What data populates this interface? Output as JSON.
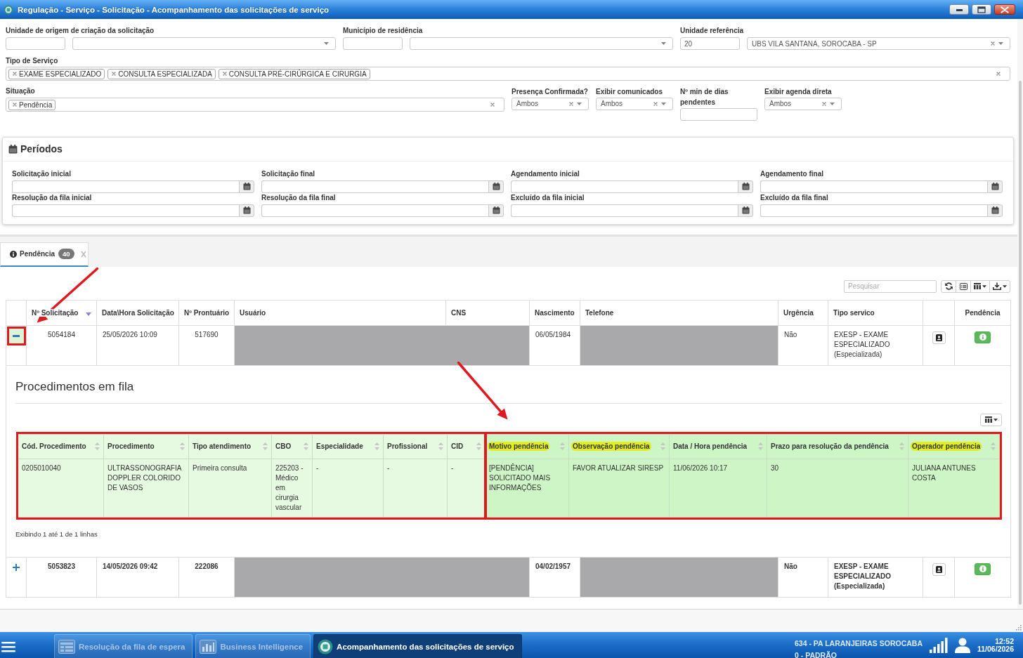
{
  "window": {
    "title": "Regulação - Serviço - Solicitação - Acompanhamento das solicitações de serviço"
  },
  "filters": {
    "lookups": [
      {
        "label": "Unidade de origem de criação da solicitação"
      },
      {
        "label": "Município de residência"
      },
      {
        "label": "Unidade referência",
        "code": "20",
        "value": "UBS VILA SANTANA, SOROCABA - SP"
      }
    ],
    "service_type": {
      "label": "Tipo de Serviço",
      "tags": [
        "EXAME ESPECIALIZADO",
        "CONSULTA ESPECIALIZADA",
        "CONSULTA PRÉ-CIRÚRGICA E CIRURGIA"
      ]
    },
    "situation": {
      "label": "Situação",
      "tags": [
        "Pendência"
      ]
    },
    "options": [
      {
        "kind": "select",
        "label": "Presença Confirmada?",
        "value": "Ambos"
      },
      {
        "kind": "select",
        "label": "Exibir comunicados",
        "value": "Ambos"
      },
      {
        "kind": "number",
        "label": "Nº min de dias pendentes"
      },
      {
        "kind": "select",
        "label": "Exibir agenda direta",
        "value": "Ambos"
      }
    ]
  },
  "periods": {
    "title": "Períodos",
    "fields": [
      "Solicitação inicial",
      "Solicitação final",
      "Agendamento inicial",
      "Agendamento final",
      "Resolução da fila inicial",
      "Resolução da fila final",
      "Excluído da fila inicial",
      "Excluído da fila final"
    ]
  },
  "tabs": [
    {
      "label": "Pendência",
      "count": "40",
      "selected": true
    }
  ],
  "search": {
    "placeholder": "Pesquisar"
  },
  "table": {
    "columns": [
      {
        "label": "Nº Solicitação",
        "sorted": true
      },
      {
        "label": "Data\\Hora Solicitação",
        "sorted": false
      },
      {
        "label": "Nº Prontuário",
        "sorted": false
      },
      {
        "label": "Usuário",
        "sorted": false
      },
      {
        "label": "CNS",
        "sorted": false
      },
      {
        "label": "Nascimento",
        "sorted": false
      },
      {
        "label": "Telefone",
        "sorted": false
      },
      {
        "label": "Urgência",
        "sorted": false
      },
      {
        "label": "Tipo servico",
        "sorted": false
      },
      {
        "label": "Pendência",
        "sorted": false
      }
    ],
    "rows": [
      {
        "expanded": true,
        "marked": true,
        "emphasized": false,
        "redacted": true,
        "number": "5054184",
        "requested_at": "25/05/2026 10:09",
        "record": "517690",
        "birth_date": "06/05/1984",
        "urgency": "Não",
        "service_type": "EXESP - EXAME ESPECIALIZADO (Especializada)",
        "detail": {
          "title": "Procedimentos em fila",
          "table": {
            "groups": [
              {
                "kind": "procedure",
                "marked": true,
                "columns": [
                  {
                    "label": "Cód. Procedimento",
                    "highlighted": false
                  },
                  {
                    "label": "Procedimento",
                    "highlighted": false
                  },
                  {
                    "label": "Tipo atendimento",
                    "highlighted": false
                  },
                  {
                    "label": "CBO",
                    "highlighted": false
                  },
                  {
                    "label": "Especialidade",
                    "highlighted": false
                  },
                  {
                    "label": "Profissional",
                    "highlighted": false
                  },
                  {
                    "label": "CID",
                    "highlighted": false
                  }
                ]
              },
              {
                "kind": "pending",
                "marked": true,
                "columns": [
                  {
                    "label": "Motivo pendência",
                    "highlighted": true
                  },
                  {
                    "label": "Observação pendência",
                    "highlighted": true
                  },
                  {
                    "label": "Data / Hora pendência",
                    "highlighted": false
                  },
                  {
                    "label": "Prazo para resolução da pendência",
                    "highlighted": false
                  },
                  {
                    "label": "Operador pendência",
                    "highlighted": true
                  }
                ]
              }
            ],
            "rows": [
              [
                "0205010040",
                "ULTRASSONOGRAFIA DOPPLER COLORIDO DE VASOS",
                "Primeira consulta",
                "225203 - Médico em cirurgia vascular",
                "-",
                "-",
                "-",
                "[PENDÊNCIA] SOLICITADO MAIS INFORMAÇÕES",
                "FAVOR ATUALIZAR SIRESP",
                "11/06/2026 10:17",
                "30",
                "JULIANA ANTUNES COSTA"
              ]
            ]
          },
          "footer": "Exibindo 1 até 1 de 1 linhas"
        }
      },
      {
        "expanded": false,
        "marked": false,
        "emphasized": true,
        "redacted": true,
        "number": "5053823",
        "requested_at": "14/05/2026 09:42",
        "record": "222086",
        "birth_date": "04/02/1957",
        "urgency": "Não",
        "service_type": "EXESP - EXAME ESPECIALIZADO (Especializada)"
      }
    ]
  },
  "taskbar": {
    "items": [
      {
        "label": "Resolução da fila de espera",
        "selected": false
      },
      {
        "label": "Business Intelligence",
        "selected": false
      },
      {
        "label": "Acompanhamento das solicitações de serviço",
        "selected": true
      }
    ],
    "location": [
      "634 - PA LARANJEIRAS SOROCABA",
      "0 - PADRÃO"
    ],
    "time": "12:52",
    "date": "11/06/2026"
  }
}
